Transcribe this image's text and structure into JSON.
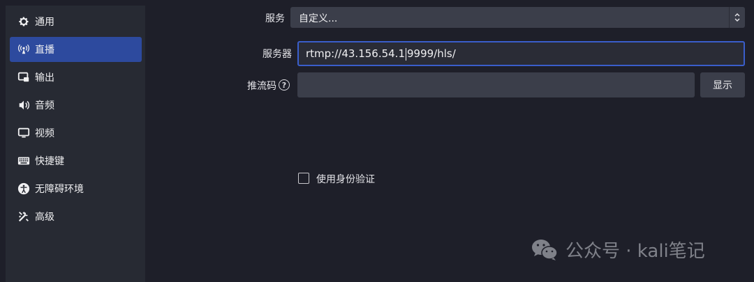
{
  "sidebar": {
    "items": [
      {
        "label": "通用",
        "icon": "gear-icon",
        "active": false
      },
      {
        "label": "直播",
        "icon": "antenna-icon",
        "active": true
      },
      {
        "label": "输出",
        "icon": "output-icon",
        "active": false
      },
      {
        "label": "音频",
        "icon": "speaker-icon",
        "active": false
      },
      {
        "label": "视频",
        "icon": "monitor-icon",
        "active": false
      },
      {
        "label": "快捷键",
        "icon": "keyboard-icon",
        "active": false
      },
      {
        "label": "无障碍环境",
        "icon": "accessibility-icon",
        "active": false
      },
      {
        "label": "高级",
        "icon": "tools-icon",
        "active": false
      }
    ]
  },
  "stream": {
    "service_label": "服务",
    "service_value": "自定义...",
    "server_label": "服务器",
    "server_value_before_caret": "rtmp://43.156.54.1",
    "server_value_after_caret": "9999/hls/",
    "key_label": "推流码",
    "key_value": "",
    "show_button": "显示",
    "auth_checkbox_label": "使用身份验证",
    "auth_checked": false
  },
  "watermark": {
    "text": "公众号 · kali笔记",
    "icon": "wechat-icon"
  },
  "colors": {
    "background": "#1e1f29",
    "sidebar": "#272a33",
    "active_item": "#2d4a9e",
    "focus_border": "#3a5ecb",
    "field": "#3b3e4a"
  }
}
